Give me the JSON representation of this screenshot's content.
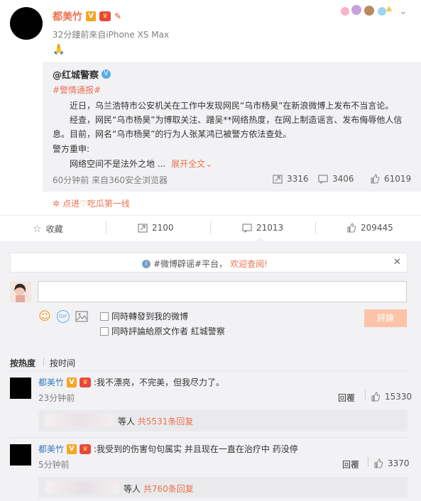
{
  "post": {
    "author": "都美竹",
    "meta": "32分鐘前來自iPhone XS Max",
    "content_emoji": "🙏",
    "colors": {
      "accent": "#eb7350",
      "link": "#3a7ab8",
      "bg_quote": "#f2f2f5"
    }
  },
  "repost": {
    "author": "@红城警察",
    "tag": "#警情通报#",
    "para1": "近日，乌兰浩特市公安机关在工作中发现网民“乌市杨昊”在新浪微博上发布不当言论。",
    "para2a": "经查，网民“乌市杨昊”为博取关注、蹭吴**网络热度，在网上制造谣言、发布侮辱他人信",
    "para2b": "息。目前，网名“乌市杨昊”的行为人张某鸿已被警方依法查处。",
    "para3": "警方重申:",
    "para4": "网络空间不是法外之地 ...",
    "expand": "展开全文",
    "meta": "60分钟前 来自360安全浏览器",
    "reposts": "3316",
    "comments": "3406",
    "likes": "61019"
  },
  "topic_link": "点进♡吃瓜第一线",
  "actions": {
    "favorite": "收藏",
    "repost": "2100",
    "comment": "21013",
    "like": "209445"
  },
  "notice": {
    "prefix": "#微博辟谣#平台，",
    "link": "欢迎查阅!"
  },
  "composer": {
    "input_value": "",
    "option1": "同時轉發到我的微博",
    "option2": "同時評論給原文作者 紅城警察",
    "submit": "評論"
  },
  "sort": {
    "hot": "按热度",
    "time": "按时间"
  },
  "comments": [
    {
      "author": "都美竹",
      "text": ":我不漂亮，不完美，但我尽力了。",
      "time": "23分钟前",
      "reply": "回覆",
      "likes": "15330",
      "sub_prefix": "等人",
      "sub_link": "共5531条回复"
    },
    {
      "author": "都美竹",
      "text": ":我受到的伤害句句属实 并且现在一直在治疗中 药没停",
      "time": "5分钟前",
      "reply": "回覆",
      "likes": "3370",
      "sub_prefix": "等人",
      "sub_link": "共760条回复"
    }
  ]
}
